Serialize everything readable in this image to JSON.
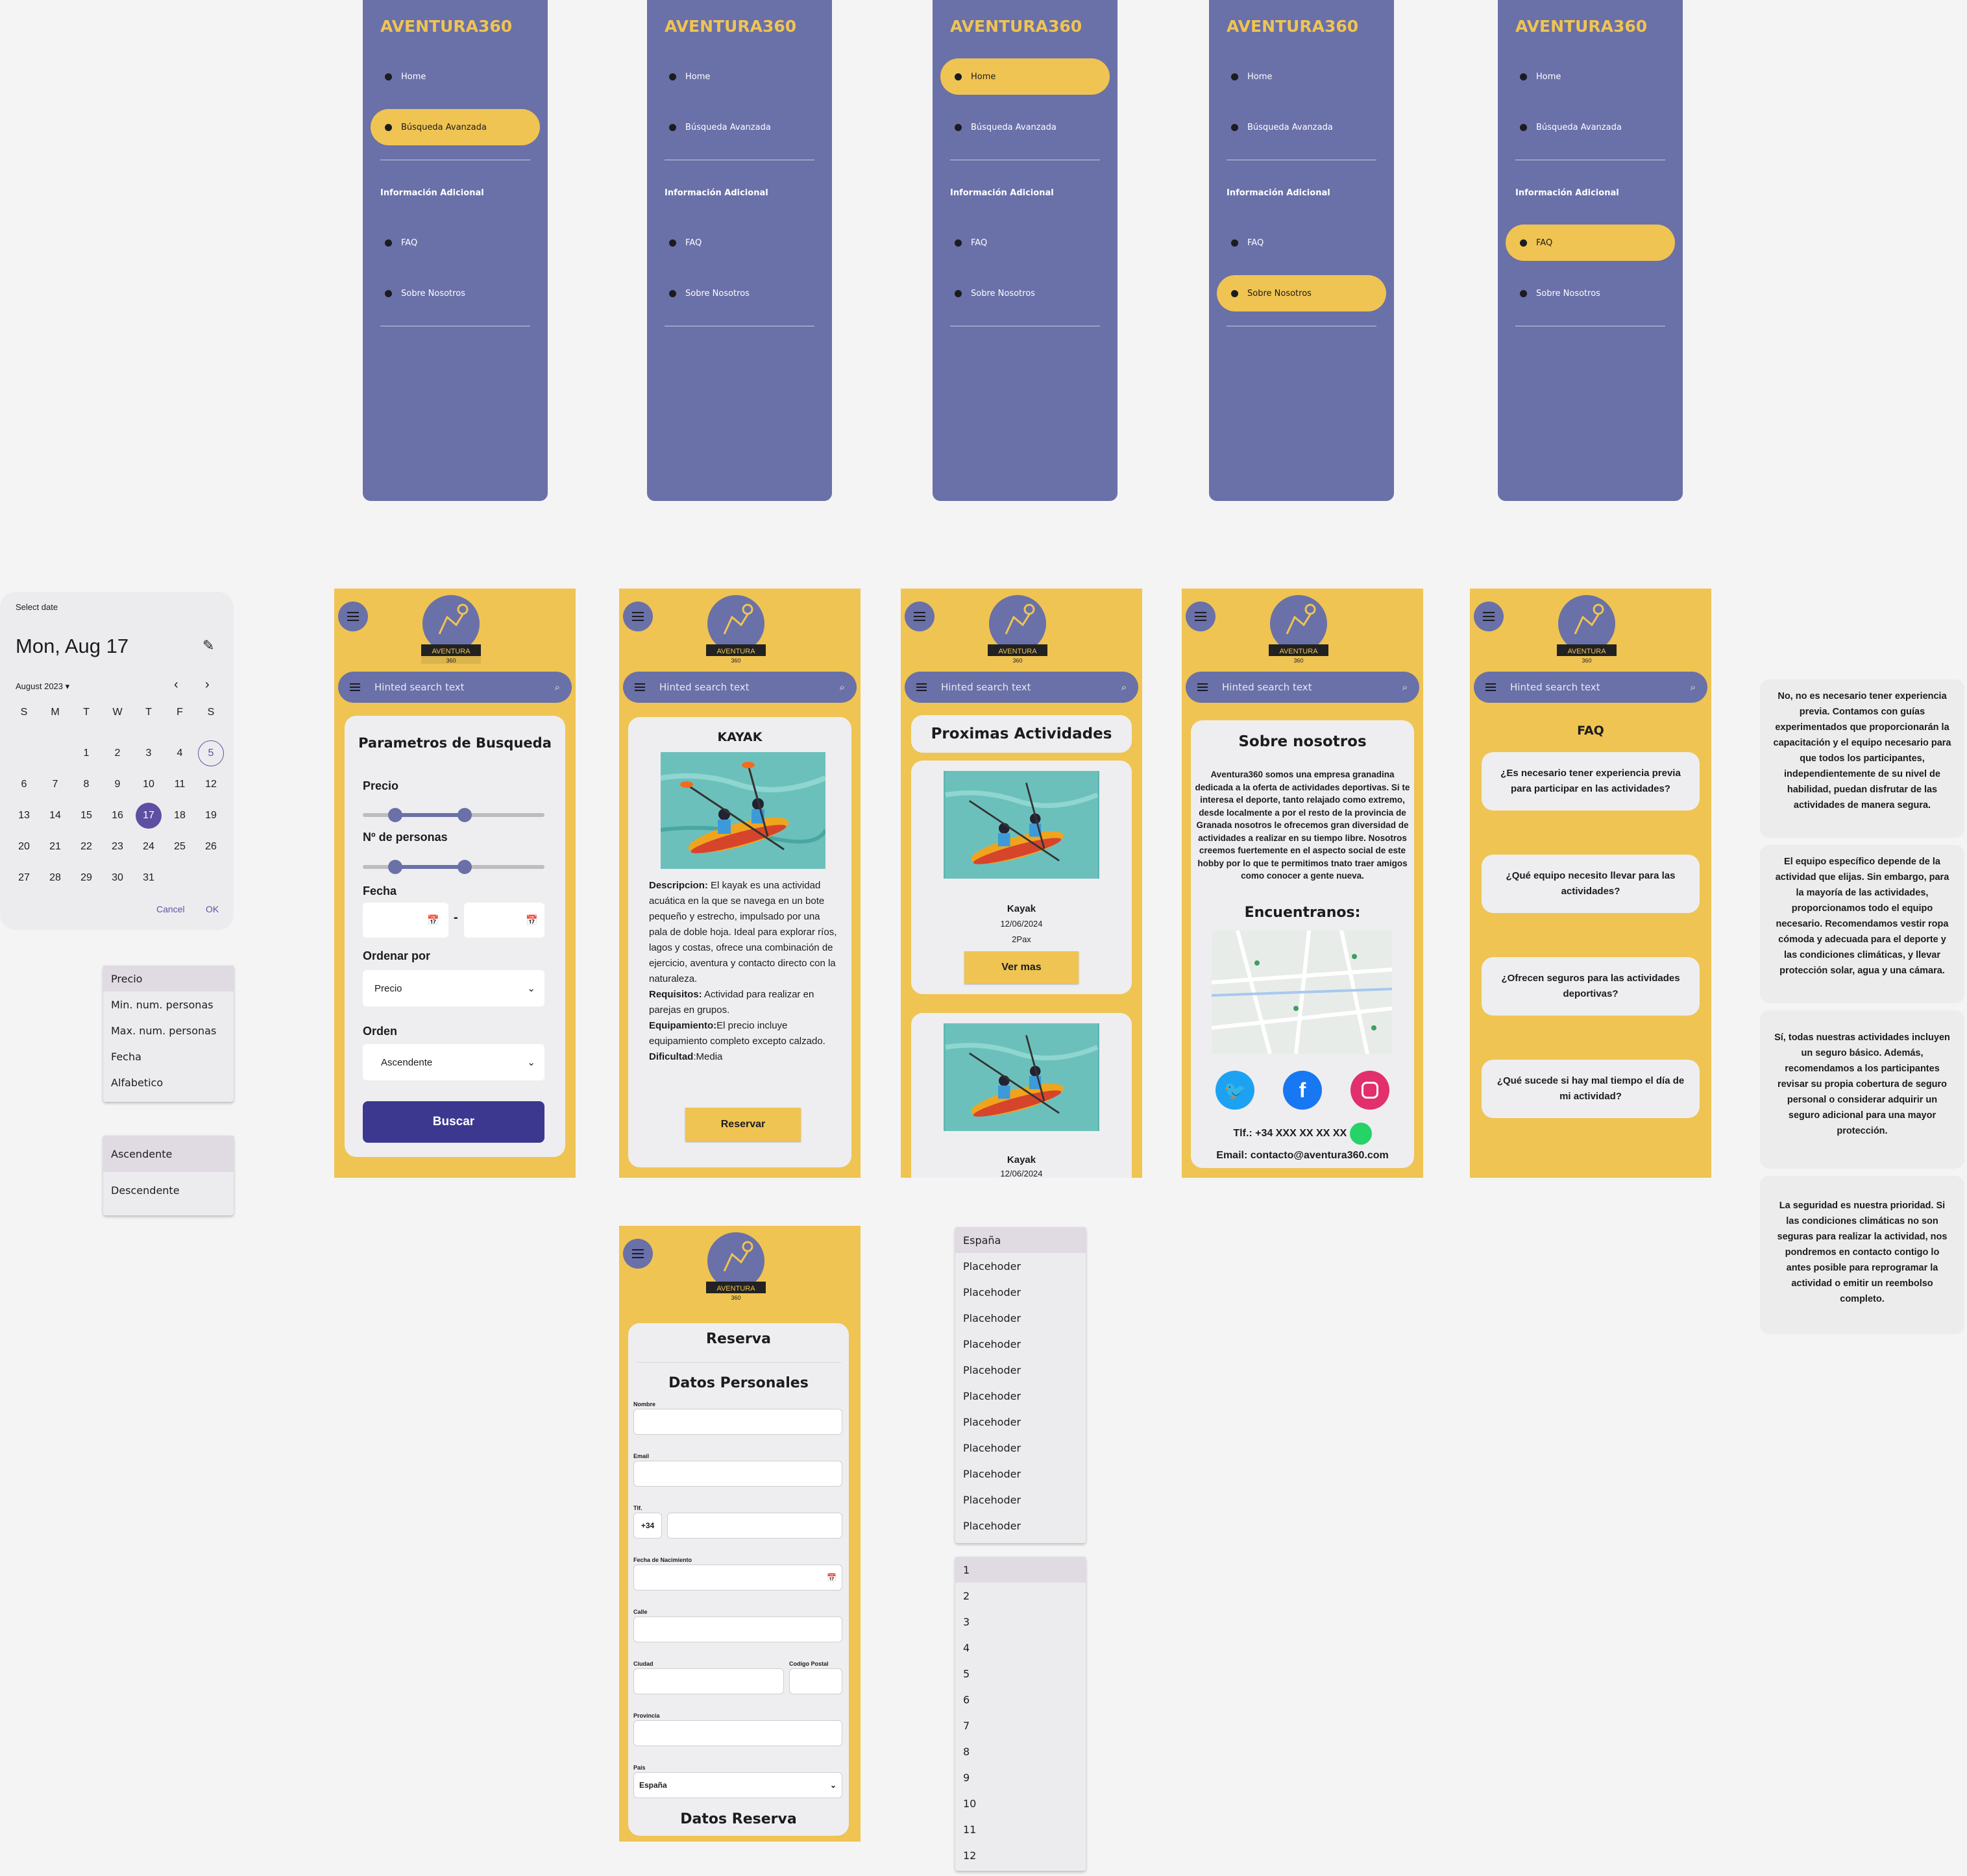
{
  "brand": "AVENTURA360",
  "logo": {
    "line1": "AVENTURA",
    "line2": "360"
  },
  "drawer": {
    "home": "Home",
    "busqueda": "Búsqueda Avanzada",
    "section": "Información Adicional",
    "faq": "FAQ",
    "sobre": "Sobre Nosotros"
  },
  "search_placeholder": "Hinted search text",
  "calendar": {
    "header": "Select date",
    "selected_date": "Mon, Aug 17",
    "month_year": "August 2023",
    "weekdays": [
      "S",
      "M",
      "T",
      "W",
      "T",
      "F",
      "S"
    ],
    "days": [
      "",
      "",
      "1",
      "2",
      "3",
      "4",
      "5",
      "6",
      "7",
      "8",
      "9",
      "10",
      "11",
      "12",
      "13",
      "14",
      "15",
      "16",
      "17",
      "18",
      "19",
      "20",
      "21",
      "22",
      "23",
      "24",
      "25",
      "26",
      "27",
      "28",
      "29",
      "30",
      "31"
    ],
    "selected_day": "17",
    "today_day": "5",
    "cancel": "Cancel",
    "ok": "OK"
  },
  "order_menu": [
    "Precio",
    "Min. num. personas",
    "Max. num. personas",
    "Fecha",
    "Alfabetico"
  ],
  "sort_menu": [
    "Ascendente",
    "Descendente"
  ],
  "params": {
    "title": "Parametros de Busqueda",
    "precio": "Precio",
    "personas": "Nº de personas",
    "fecha": "Fecha",
    "dash": "-",
    "ordenar": "Ordenar por",
    "ordenar_value": "Precio",
    "orden": "Orden",
    "orden_value": "Ascendente",
    "buscar": "Buscar",
    "precio_range": [
      0.18,
      0.56
    ],
    "personas_range": [
      0.18,
      0.56
    ]
  },
  "kayak": {
    "title": "KAYAK",
    "desc_label": "Descripcion:",
    "desc": " El kayak es una actividad acuática en la que se navega en un bote pequeño y estrecho, impulsado por una pala de doble hoja. Ideal para explorar ríos, lagos y costas, ofrece una combinación de ejercicio, aventura y contacto directo con la naturaleza.",
    "req_label": "Requisitos:",
    "req": " Actividad para realizar en parejas en grupos.",
    "equip_label": "Equipamiento:",
    "equip": "El precio incluye equipamiento completo excepto calzado.",
    "dif_label": "Dificultad",
    "dif": ":Media",
    "reservar": "Reservar"
  },
  "proximas": {
    "title": "Proximas Actividades",
    "item1": {
      "name": "Kayak",
      "date": "12/06/2024",
      "pax": "2Pax",
      "btn": "Ver mas"
    },
    "item2": {
      "name": "Kayak",
      "date": "12/06/2024"
    }
  },
  "sobre": {
    "title": "Sobre nosotros",
    "text": "Aventura360 somos una empresa granadina dedicada a la oferta de actividades deportivas. Si te interesa el deporte, tanto relajado como extremo, desde localmente a por el resto de la provincia de Granada nosotros le ofrecemos gran diversidad de actividades a realizar en su tiempo libre. Nosotros creemos fuertemente en el aspecto social de este hobby por lo que te permitimos tnato traer amigos como conocer a gente nueva.",
    "encuentranos": "Encuentranos:",
    "tlf": "Tlf.: +34 XXX XX XX XX",
    "email": "Email: contacto@aventura360.com"
  },
  "faq": {
    "title": "FAQ",
    "questions": [
      "¿Es necesario tener experiencia previa para participar en las actividades?",
      "¿Qué equipo necesito llevar para las actividades?",
      "¿Ofrecen seguros para las actividades deportivas?",
      "¿Qué sucede si hay mal tiempo el día de mi actividad?"
    ],
    "answers": [
      "No, no es necesario tener experiencia previa. Contamos con guías experimentados que proporcionarán la capacitación y el equipo necesario para que todos los participantes, independientemente de su nivel de habilidad, puedan disfrutar de las actividades de manera segura.",
      "El equipo específico depende de la actividad que elijas. Sin embargo, para la mayoría de las actividades, proporcionamos todo el equipo necesario. Recomendamos vestir ropa cómoda y adecuada para el deporte y las condiciones climáticas, y llevar protección solar, agua y una cámara.",
      "Sí, todas nuestras actividades incluyen un seguro básico. Además, recomendamos a los participantes revisar su propia cobertura de seguro personal o considerar adquirir un seguro adicional para una mayor protección.",
      "La seguridad es nuestra prioridad. Si las condiciones climáticas no son seguras para realizar la actividad, nos pondremos en contacto contigo lo antes posible para reprogramar la actividad o emitir un reembolso completo."
    ]
  },
  "reserva": {
    "title": "Reserva",
    "datos": "Datos Personales",
    "nombre": "Nombre",
    "email": "Email",
    "tlf": "Tlf.",
    "prefix": "+34",
    "nacimiento": "Fecha de Nacimiento",
    "calle": "Calle",
    "ciudad": "Ciudad",
    "cp": "Codigo Postal",
    "provincia": "Provincia",
    "pais": "País",
    "pais_value": "España",
    "datos_reserva": "Datos Reserva"
  },
  "country_menu": [
    "España",
    "Placehoder",
    "Placehoder",
    "Placehoder",
    "Placehoder",
    "Placehoder",
    "Placehoder",
    "Placehoder",
    "Placehoder",
    "Placehoder",
    "Placehoder",
    "Placehoder"
  ],
  "number_menu": [
    "1",
    "2",
    "3",
    "4",
    "5",
    "6",
    "7",
    "8",
    "9",
    "10",
    "11",
    "12"
  ],
  "colors": {
    "primary": "#6a70a8",
    "accent": "#efc452",
    "button": "#3c3890"
  }
}
